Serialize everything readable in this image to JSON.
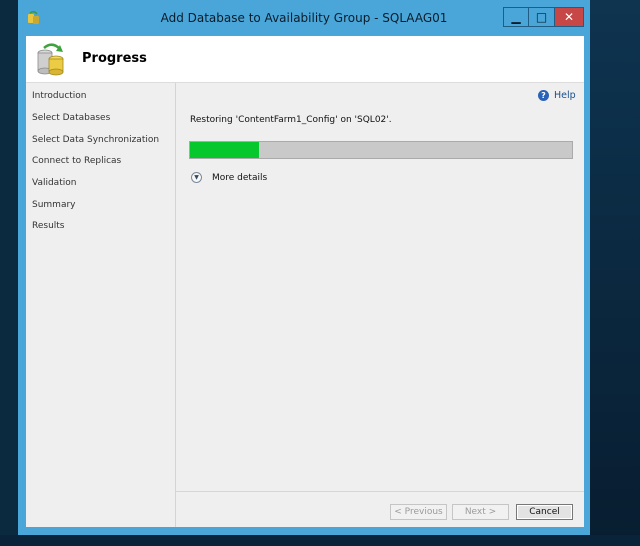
{
  "window": {
    "title": "Add Database to Availability Group - SQLAAG01",
    "minimize_label": "▁",
    "maximize_label": "□",
    "close_label": "✕"
  },
  "header": {
    "title": "Progress"
  },
  "nav": {
    "items": [
      {
        "label": "Introduction"
      },
      {
        "label": "Select Databases"
      },
      {
        "label": "Select Data Synchronization"
      },
      {
        "label": "Connect to Replicas"
      },
      {
        "label": "Validation"
      },
      {
        "label": "Summary"
      },
      {
        "label": "Results"
      }
    ]
  },
  "main": {
    "help_label": "Help",
    "status_text": "Restoring 'ContentFarm1_Config' on 'SQL02'.",
    "progress_percent": 18,
    "more_details_label": "More details"
  },
  "footer": {
    "previous_label": "< Previous",
    "next_label": "Next >",
    "cancel_label": "Cancel"
  },
  "colors": {
    "progress_fill": "#06c72b",
    "title_bar": "#4aa6d8",
    "close_button": "#c74646"
  },
  "icons": {
    "app": "database-icon",
    "header": "database-sync-icon",
    "help": "help-icon",
    "expander": "chevron-down-icon"
  }
}
